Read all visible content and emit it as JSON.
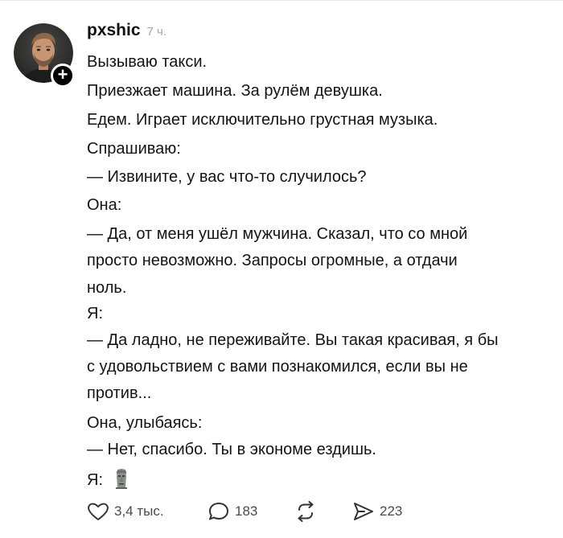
{
  "post": {
    "author": "pxshic",
    "time": "7 ч.",
    "lines": [
      "Вызываю такси.",
      "Приезжает машина. За рулём девушка.",
      "Едем. Играет исключительно грустная музыка.",
      "Спрашиваю:",
      "— Извините, у вас что-то случилось?",
      "Она:",
      "— Да, от меня ушёл мужчина. Сказал, что со мной",
      "просто невозможно. Запросы огромные, а отдачи",
      "ноль.",
      "Я:",
      "— Да ладно, не переживайте. Вы такая красивая, я бы",
      "с удовольствием с вами познакомился, если вы не",
      "против...",
      "Она, улыбаясь:",
      "— Нет, спасибо. Ты в экономе ездишь.",
      "Я:"
    ],
    "final_emoji": "moai-emoji"
  },
  "actions": {
    "likes": "3,4 тыс.",
    "comments": "183",
    "reposts": "",
    "shares": "223"
  },
  "icons": {
    "like": "heart-icon",
    "comment": "comment-bubble-icon",
    "repost": "repost-arrows-icon",
    "share": "send-arrow-icon",
    "follow": "plus-icon"
  }
}
